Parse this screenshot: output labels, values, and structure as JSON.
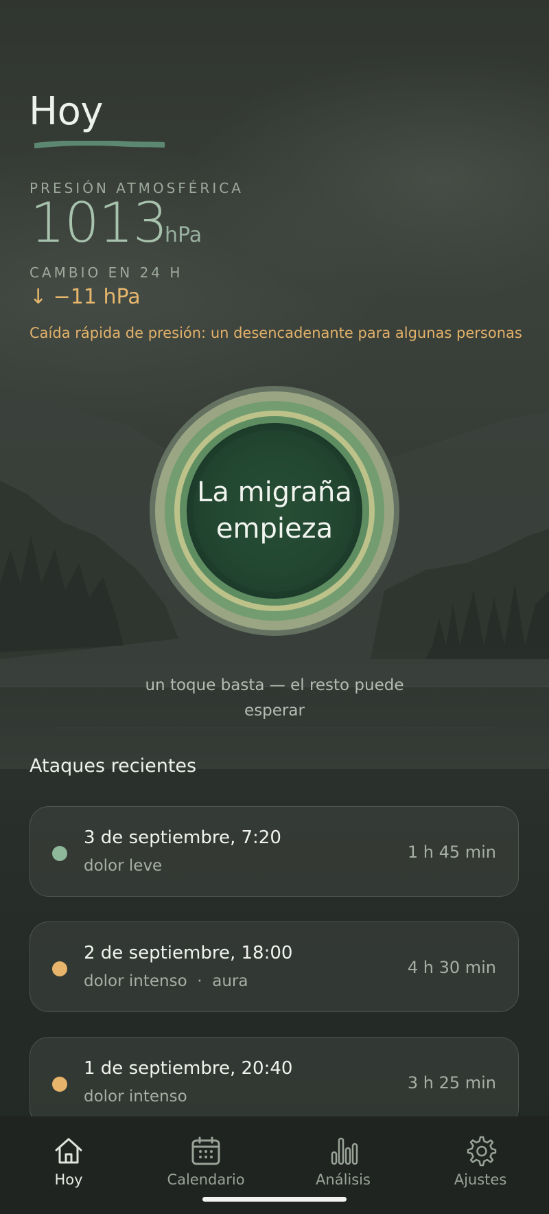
{
  "header": {
    "title": "Hoy"
  },
  "pressure": {
    "label": "PRESIÓN ATMOSFÉRICA",
    "value": "1013",
    "unit": "hPa",
    "change_label": "CAMBIO EN 24 H",
    "change_value": "↓ −11 hPa",
    "alert": "Caída rápida de presión: un desencadenante para algunas personas"
  },
  "trigger": {
    "label": "La migraña empieza",
    "hint": "un toque basta — el resto puede esperar"
  },
  "recent": {
    "title": "Ataques recientes",
    "items": [
      {
        "date": "3 de septiembre, 7:20",
        "detail": "dolor leve",
        "duration": "1 h 45 min",
        "severity_color": "#8fb89a"
      },
      {
        "date": "2 de septiembre, 18:00",
        "detail": "dolor intenso  ·  aura",
        "duration": "4 h 30 min",
        "severity_color": "#e6b46a"
      },
      {
        "date": "1 de septiembre, 20:40",
        "detail": "dolor intenso",
        "duration": "3 h 25 min",
        "severity_color": "#e6b46a"
      }
    ]
  },
  "tabs": [
    {
      "label": "Hoy",
      "icon": "home-icon",
      "active": true
    },
    {
      "label": "Calendario",
      "icon": "calendar-icon",
      "active": false
    },
    {
      "label": "Análisis",
      "icon": "bar-chart-icon",
      "active": false
    },
    {
      "label": "Ajustes",
      "icon": "gear-icon",
      "active": false
    }
  ],
  "colors": {
    "accent_green": "#a8c3ad",
    "warning_amber": "#e3b26a",
    "tab_bar": "#1f2420"
  }
}
